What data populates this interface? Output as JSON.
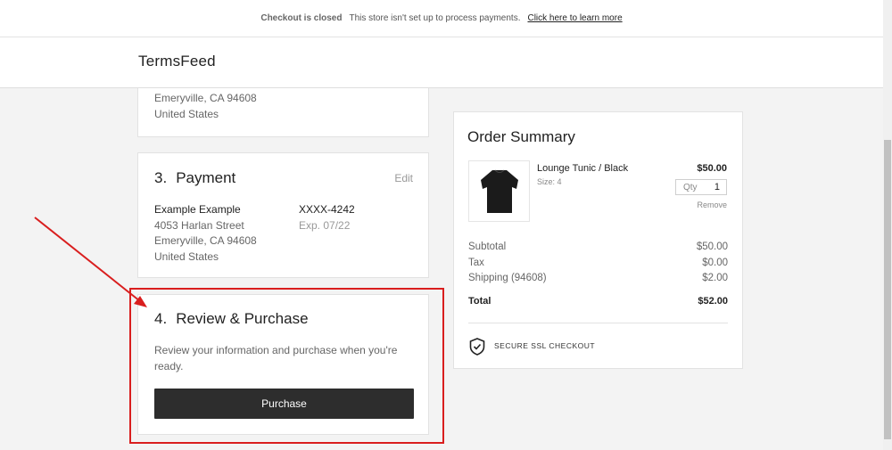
{
  "notice": {
    "status": "Checkout is closed",
    "message": "This store isn't set up to process payments.",
    "link": "Click here to learn more"
  },
  "header": {
    "brand": "TermsFeed"
  },
  "shipping": {
    "city_line": "Emeryville, CA 94608",
    "country": "United States"
  },
  "payment": {
    "step_num": "3.",
    "title": "Payment",
    "edit_label": "Edit",
    "billing_name": "Example Example",
    "billing_street": "4053 Harlan Street",
    "billing_city": "Emeryville, CA 94608",
    "billing_country": "United States",
    "card_number": "XXXX-4242",
    "card_exp": "Exp. 07/22"
  },
  "review": {
    "step_num": "4.",
    "title": "Review & Purchase",
    "text": "Review your information and purchase when you're ready.",
    "button_label": "Purchase"
  },
  "summary": {
    "title": "Order Summary",
    "item": {
      "name": "Lounge Tunic / Black",
      "size": "Size: 4",
      "price": "$50.00",
      "qty_label": "Qty",
      "qty_value": "1",
      "remove_label": "Remove"
    },
    "subtotal_label": "Subtotal",
    "subtotal_value": "$50.00",
    "tax_label": "Tax",
    "tax_value": "$0.00",
    "shipping_label": "Shipping (94608)",
    "shipping_value": "$2.00",
    "total_label": "Total",
    "total_value": "$52.00",
    "ssl_label": "SECURE SSL CHECKOUT"
  },
  "annotation_color": "#d91e1e",
  "icons": [
    "tunic-thumbnail",
    "shield-check-icon",
    "red-arrow-annotation"
  ]
}
